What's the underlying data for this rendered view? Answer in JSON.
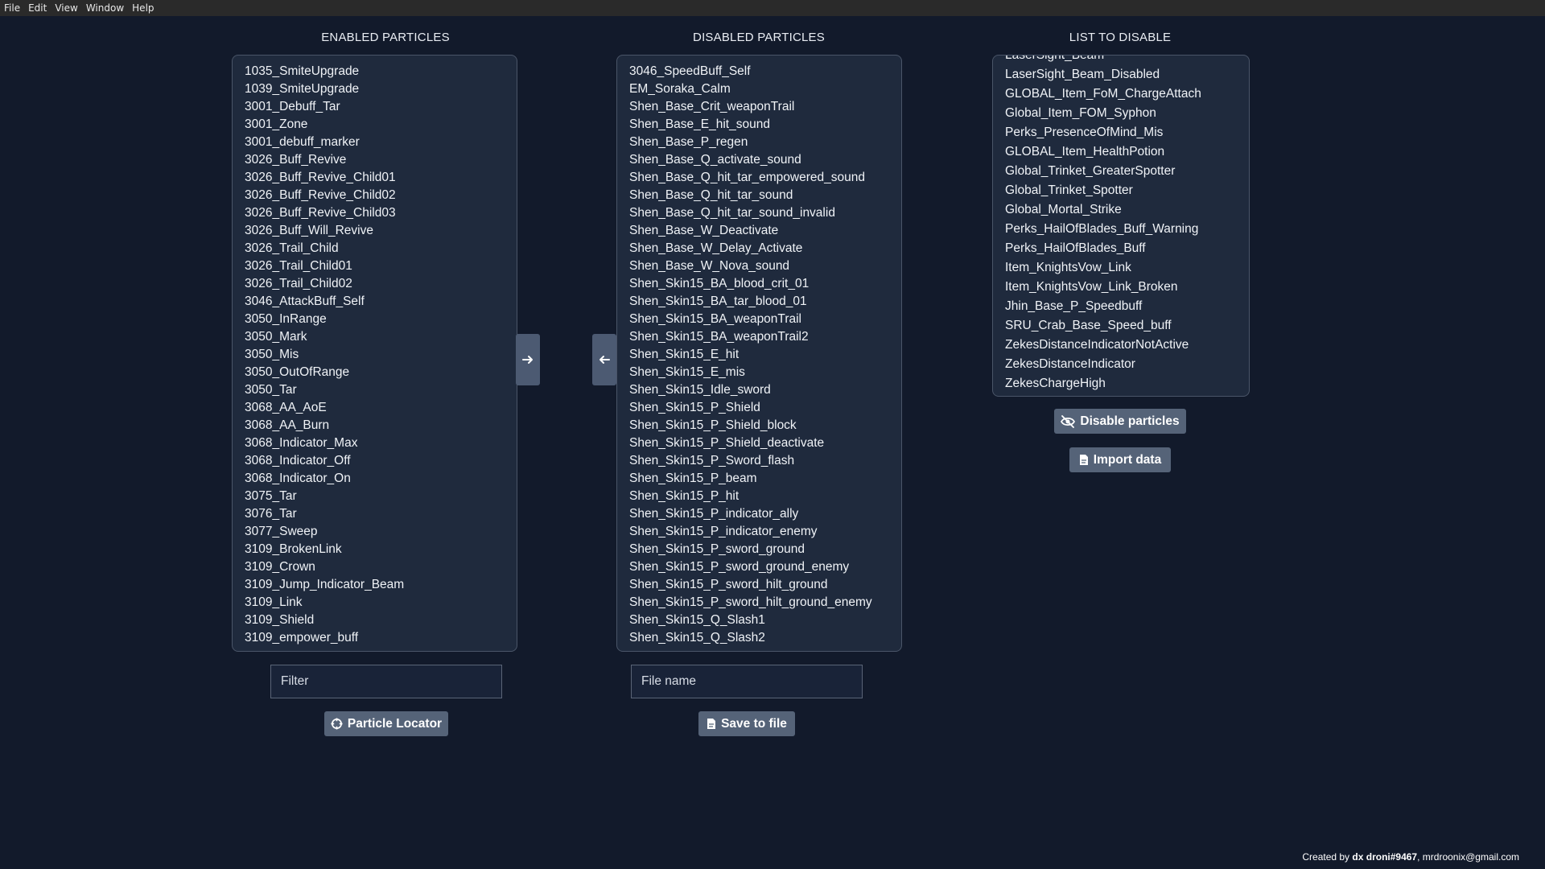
{
  "menu": [
    "File",
    "Edit",
    "View",
    "Window",
    "Help"
  ],
  "enabled": {
    "title": "ENABLED PARTICLES",
    "items": [
      "1035_SmiteUpgrade",
      "1039_SmiteUpgrade",
      "3001_Debuff_Tar",
      "3001_Zone",
      "3001_debuff_marker",
      "3026_Buff_Revive",
      "3026_Buff_Revive_Child01",
      "3026_Buff_Revive_Child02",
      "3026_Buff_Revive_Child03",
      "3026_Buff_Will_Revive",
      "3026_Trail_Child",
      "3026_Trail_Child01",
      "3026_Trail_Child02",
      "3046_AttackBuff_Self",
      "3050_InRange",
      "3050_Mark",
      "3050_Mis",
      "3050_OutOfRange",
      "3050_Tar",
      "3068_AA_AoE",
      "3068_AA_Burn",
      "3068_Indicator_Max",
      "3068_Indicator_Off",
      "3068_Indicator_On",
      "3075_Tar",
      "3076_Tar",
      "3077_Sweep",
      "3109_BrokenLink",
      "3109_Crown",
      "3109_Jump_Indicator_Beam",
      "3109_Link",
      "3109_Shield",
      "3109_empower_buff"
    ],
    "filter_placeholder": "Filter",
    "locator_label": "Particle Locator"
  },
  "disabled": {
    "title": "DISABLED PARTICLES",
    "items": [
      "3046_SpeedBuff_Self",
      "EM_Soraka_Calm",
      "Shen_Base_Crit_weaponTrail",
      "Shen_Base_E_hit_sound",
      "Shen_Base_P_regen",
      "Shen_Base_Q_activate_sound",
      "Shen_Base_Q_hit_tar_empowered_sound",
      "Shen_Base_Q_hit_tar_sound",
      "Shen_Base_Q_hit_tar_sound_invalid",
      "Shen_Base_W_Deactivate",
      "Shen_Base_W_Delay_Activate",
      "Shen_Base_W_Nova_sound",
      "Shen_Skin15_BA_blood_crit_01",
      "Shen_Skin15_BA_tar_blood_01",
      "Shen_Skin15_BA_weaponTrail",
      "Shen_Skin15_BA_weaponTrail2",
      "Shen_Skin15_E_hit",
      "Shen_Skin15_E_mis",
      "Shen_Skin15_Idle_sword",
      "Shen_Skin15_P_Shield",
      "Shen_Skin15_P_Shield_block",
      "Shen_Skin15_P_Shield_deactivate",
      "Shen_Skin15_P_Sword_flash",
      "Shen_Skin15_P_beam",
      "Shen_Skin15_P_hit",
      "Shen_Skin15_P_indicator_ally",
      "Shen_Skin15_P_indicator_enemy",
      "Shen_Skin15_P_sword_ground",
      "Shen_Skin15_P_sword_ground_enemy",
      "Shen_Skin15_P_sword_hilt_ground",
      "Shen_Skin15_P_sword_hilt_ground_enemy",
      "Shen_Skin15_Q_Slash1",
      "Shen_Skin15_Q_Slash2"
    ],
    "filename_placeholder": "File name",
    "save_label": "Save to file"
  },
  "to_disable": {
    "title": "LIST TO DISABLE",
    "items": [
      "LaserSight_Beam",
      "LaserSight_Beam_Disabled",
      "GLOBAL_Item_FoM_ChargeAttach",
      "Global_Item_FOM_Syphon",
      "Perks_PresenceOfMind_Mis",
      "GLOBAL_Item_HealthPotion",
      "Global_Trinket_GreaterSpotter",
      "Global_Trinket_Spotter",
      "Global_Mortal_Strike",
      "Perks_HailOfBlades_Buff_Warning",
      "Perks_HailOfBlades_Buff",
      "Item_KnightsVow_Link",
      "Item_KnightsVow_Link_Broken",
      "Jhin_Base_P_Speedbuff",
      "SRU_Crab_Base_Speed_buff",
      "ZekesDistanceIndicatorNotActive",
      "ZekesDistanceIndicator",
      "ZekesChargeHigh"
    ],
    "disable_label": "Disable particles",
    "import_label": "Import data"
  },
  "footer": {
    "prefix": "Created by ",
    "author": "dx droni#9467",
    "email": ", mrdroonix@gmail.com"
  },
  "icons": {
    "move_right": "arrow-right-icon",
    "move_left": "arrow-left-icon",
    "locator": "crosshair-icon",
    "save": "file-icon",
    "disable": "eye-off-icon",
    "import": "file-icon"
  }
}
